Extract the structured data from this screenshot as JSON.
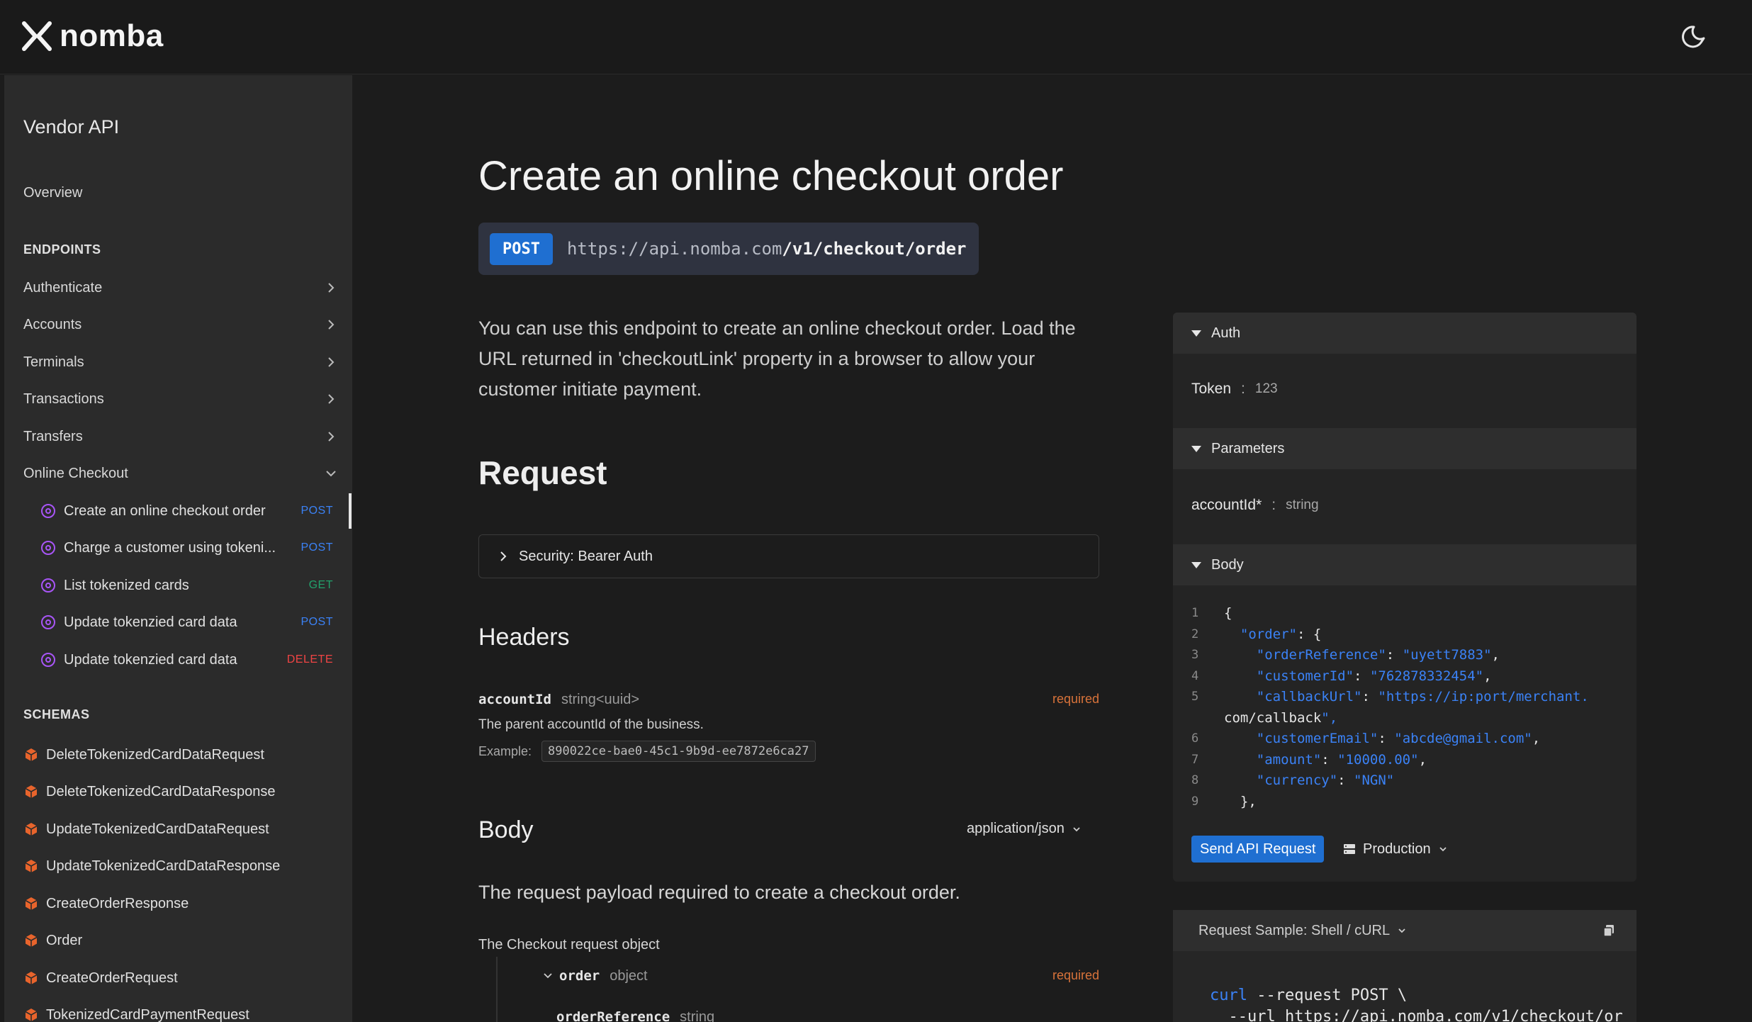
{
  "brand": {
    "name": "nomba"
  },
  "sidebar": {
    "title": "Vendor API",
    "overview": "Overview",
    "endpoints_heading": "ENDPOINTS",
    "groups": [
      {
        "label": "Authenticate"
      },
      {
        "label": "Accounts"
      },
      {
        "label": "Terminals"
      },
      {
        "label": "Transactions"
      },
      {
        "label": "Transfers"
      },
      {
        "label": "Online Checkout"
      }
    ],
    "checkout_items": [
      {
        "label": "Create an online checkout order",
        "method": "POST"
      },
      {
        "label": "Charge a customer using tokeni...",
        "method": "POST"
      },
      {
        "label": "List tokenized cards",
        "method": "GET"
      },
      {
        "label": "Update tokenzied card data",
        "method": "POST"
      },
      {
        "label": "Update tokenzied card data",
        "method": "DELETE"
      }
    ],
    "schemas_heading": "SCHEMAS",
    "schemas": [
      "DeleteTokenizedCardDataRequest",
      "DeleteTokenizedCardDataResponse",
      "UpdateTokenizedCardDataRequest",
      "UpdateTokenizedCardDataResponse",
      "CreateOrderResponse",
      "Order",
      "CreateOrderRequest",
      "TokenizedCardPaymentRequest"
    ]
  },
  "main": {
    "title": "Create an online checkout order",
    "method": "POST",
    "url_base": "https://api.nomba.com",
    "url_path": "/v1/checkout/order",
    "description": "You can use this endpoint to create an online checkout order. Load the URL returned in 'checkoutLink' property in a browser to allow your customer initiate payment.",
    "request_heading": "Request",
    "security_label": "Security: Bearer Auth",
    "headers_heading": "Headers",
    "header_field": {
      "name": "accountId",
      "type": "string<uuid>",
      "required": "required",
      "description": "The parent accountId of the business.",
      "example_label": "Example:",
      "example_value": "890022ce-bae0-45c1-9b9d-ee7872e6ca27"
    },
    "body_heading": "Body",
    "content_type": "application/json",
    "payload_text": "The request payload required to create a checkout order.",
    "request_object_label": "The Checkout request object",
    "order_field": {
      "name": "order",
      "type": "object",
      "required": "required"
    },
    "order_reference_field": {
      "name": "orderReference",
      "type": "string"
    }
  },
  "panel": {
    "auth_heading": "Auth",
    "token_label": "Token",
    "token_sep": ":",
    "token_value": "123",
    "params_heading": "Parameters",
    "param_label": "accountId*",
    "param_sep": ":",
    "param_value": "string",
    "body_heading": "Body",
    "code_lines": [
      {
        "n": "1",
        "text": "{"
      },
      {
        "n": "2",
        "text": "  \"order\": {"
      },
      {
        "n": "3",
        "text": "    \"orderReference\": \"uyett7883\","
      },
      {
        "n": "4",
        "text": "    \"customerId\": \"762878332454\","
      },
      {
        "n": "5",
        "text": "    \"callbackUrl\": \"https://ip:port/merchant."
      },
      {
        "n": "",
        "text": "com/callback\","
      },
      {
        "n": "6",
        "text": "    \"customerEmail\": \"abcde@gmail.com\","
      },
      {
        "n": "7",
        "text": "    \"amount\": \"10000.00\","
      },
      {
        "n": "8",
        "text": "    \"currency\": \"NGN\""
      },
      {
        "n": "9",
        "text": "  },"
      }
    ],
    "send_button": "Send API Request",
    "environment": "Production"
  },
  "sample": {
    "heading": "Request Sample: Shell / cURL",
    "line1_cmd": "curl",
    "line1_rest": " --request POST \\",
    "line2": "  --url https://api.nomba.com/v1/checkout/or"
  }
}
